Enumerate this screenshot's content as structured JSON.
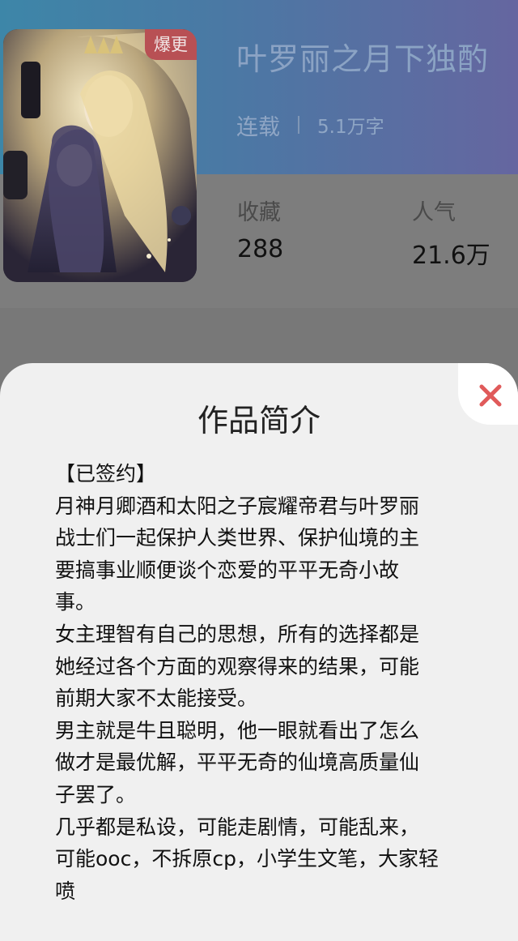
{
  "book": {
    "title": "叶罗丽之月下独酌",
    "status": "连载",
    "word_count": "5.1万字",
    "cover_tag": "爆更"
  },
  "stats": {
    "favorites_label": "收藏",
    "favorites_value": "288",
    "popularity_label": "人气",
    "popularity_value": "21.6万"
  },
  "intro": {
    "heading": "作品简介",
    "lines": [
      "【已签约】",
      "月神月卿酒和太阳之子宸耀帝君与叶罗丽",
      "战士们一起保护人类世界、保护仙境的主",
      "要搞事业顺便谈个恋爱的平平无奇小故",
      "事。",
      "女主理智有自己的思想，所有的选择都是",
      "她经过各个方面的观察得来的结果，可能",
      "前期大家不太能接受。",
      "男主就是牛且聪明，他一眼就看出了怎么",
      "做才是最优解，平平无奇的仙境高质量仙",
      "子罢了。",
      "几乎都是私设，可能走剧情，可能乱来，",
      "可能ooc，不拆原cp，小学生文笔，大家轻",
      "喷"
    ]
  },
  "icons": {
    "close": "close-icon"
  },
  "colors": {
    "header_gradient_start": "#3d86a8",
    "header_gradient_end": "#6566a0",
    "tag_background": "#b85054",
    "close_icon": "#e05a5a",
    "sheet_background": "#f0f0f0"
  }
}
